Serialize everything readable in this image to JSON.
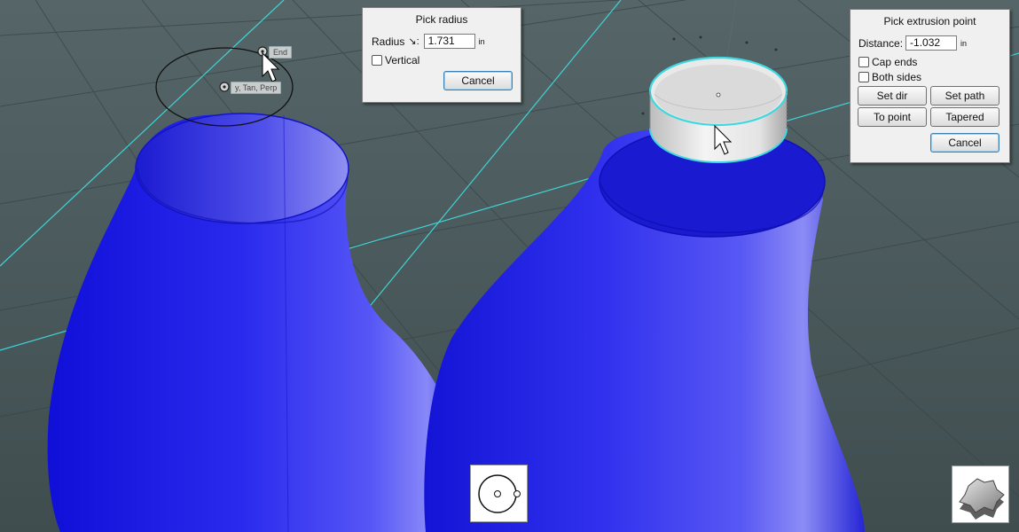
{
  "viewport": {
    "snaps": {
      "end_label": "End",
      "tan_label": "y, Tan, Perp"
    }
  },
  "pick_radius": {
    "title": "Pick radius",
    "radius_label": "Radius",
    "radius_value": "1.731",
    "unit": "in",
    "vertical_label": "Vertical",
    "vertical_checked": false,
    "cancel_label": "Cancel"
  },
  "pick_extrusion": {
    "title": "Pick extrusion point",
    "distance_label": "Distance:",
    "distance_value": "-1.032",
    "unit": "in",
    "cap_ends_label": "Cap ends",
    "both_sides_label": "Both sides",
    "set_dir_label": "Set dir",
    "set_path_label": "Set path",
    "to_point_label": "To point",
    "tapered_label": "Tapered",
    "cancel_label": "Cancel"
  },
  "tool_icons": {
    "circle_tool": "circle-radius-icon",
    "extrude_tool": "extrude-gear-icon"
  },
  "colors": {
    "background": "#4a5a5c",
    "grid_accent": "#3fd3d6",
    "vase_blue": "#1f1fe6",
    "selection_cyan": "#3fd8e0"
  }
}
